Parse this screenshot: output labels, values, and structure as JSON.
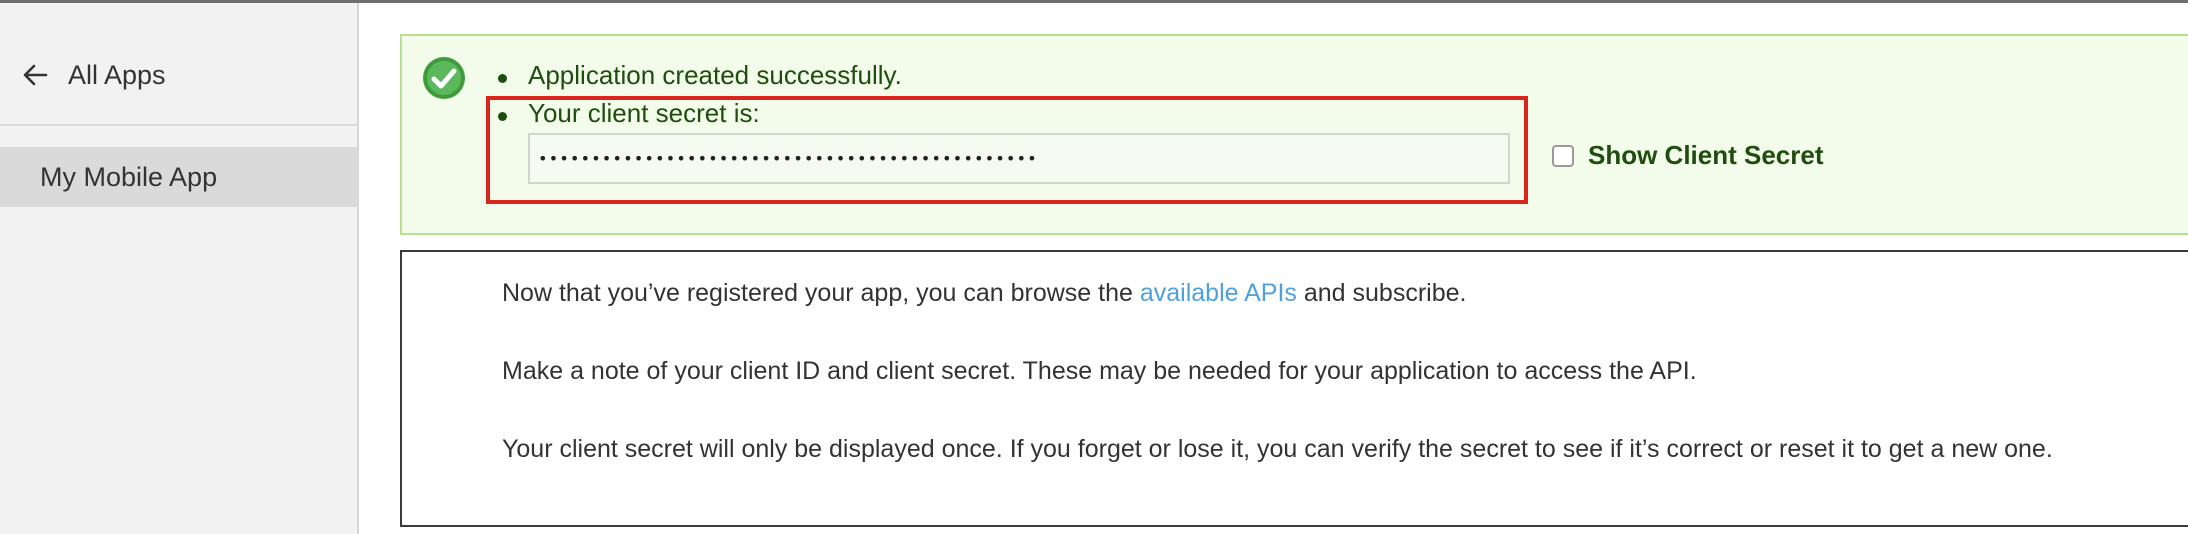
{
  "sidebar": {
    "back_icon": "arrow-left-icon",
    "back_label": "All Apps",
    "items": [
      {
        "label": "My Mobile App",
        "selected": true
      }
    ]
  },
  "alert": {
    "icon": "check-circle-icon",
    "success_message": "Application created successfully.",
    "secret_label": "Your client secret is:",
    "secret_value": "•••••••••••••••••••••••••••••••••••••••••••••••",
    "show_secret_label": "Show Client Secret",
    "show_secret_checked": false
  },
  "info": {
    "line1_before": "Now that you’ve registered your app, you can browse the ",
    "line1_link": "available APIs",
    "line1_after": " and subscribe.",
    "line2": "Make a note of your client ID and client secret. These may be needed for your application to access the API.",
    "line3": "Your client secret will only be displayed once. If you forget or lose it, you can verify the secret to see if it’s correct or reset it to get a new one."
  },
  "colors": {
    "success_green": "#5cb85c",
    "success_text": "#1e4d0e",
    "highlight_red": "#d9251c",
    "link_blue": "#4ea1dc"
  }
}
